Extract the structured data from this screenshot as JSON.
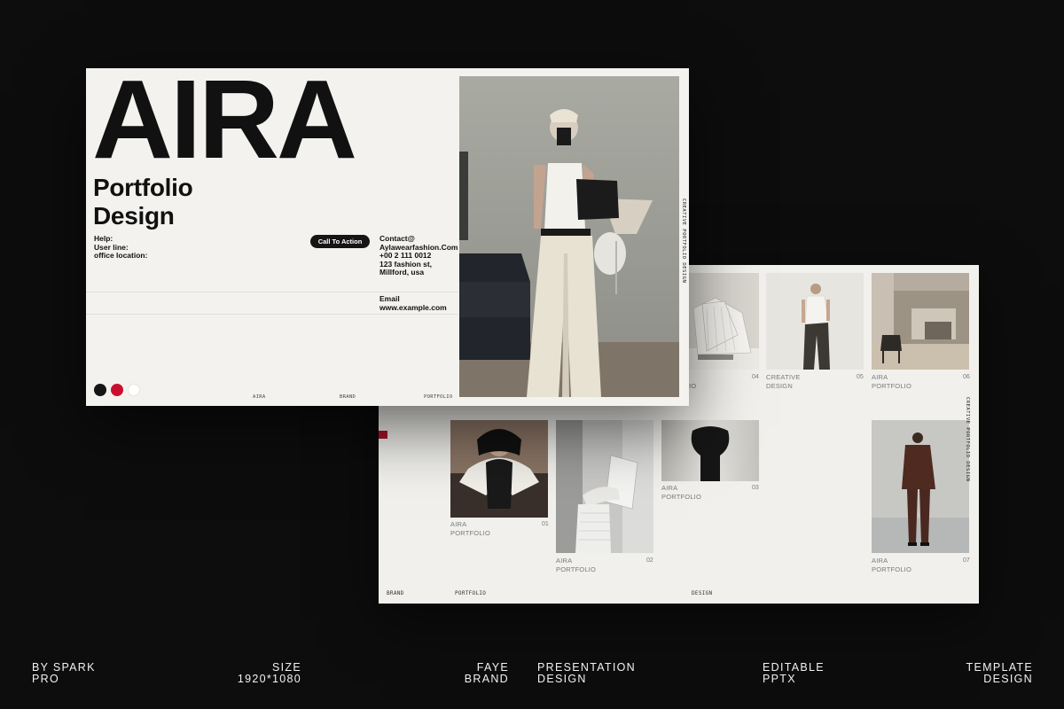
{
  "front_slide": {
    "title": "AIRA",
    "subtitle_line1": "Portfolio",
    "subtitle_line2": "Design",
    "help_lines": [
      "Help:",
      "User line:",
      "office location:"
    ],
    "cta_label": "Call To Action",
    "contact_lines": [
      "Contact@",
      "Aylawearfashion.Com",
      "+00 2 111 0012",
      "123 fashion st,",
      "Millford, usa"
    ],
    "email_lines": [
      "Email",
      "www.example.com"
    ],
    "footer": [
      "AIRA",
      "BRAND",
      "PORTFOLIO"
    ],
    "vertical_label": "CREATIVE PORTFOLIO DESIGN",
    "swatch_colors": [
      "#151515",
      "#c8102e",
      "#ffffff"
    ]
  },
  "back_slide": {
    "items": [
      {
        "num": "01",
        "line1": "AIRA",
        "line2": "PORTFOLIO"
      },
      {
        "num": "02",
        "line1": "AIRA",
        "line2": "PORTFOLIO"
      },
      {
        "num": "03",
        "line1": "AIRA",
        "line2": "PORTFOLIO"
      },
      {
        "num": "04",
        "line1": "",
        "line2": "IO"
      },
      {
        "num": "05",
        "line1": "CREATIVE",
        "line2": "DESIGN"
      },
      {
        "num": "06",
        "line1": "AIRA",
        "line2": "PORTFOLIO"
      },
      {
        "num": "07",
        "line1": "AIRA",
        "line2": "PORTFOLIO"
      }
    ],
    "footer": [
      "BRAND",
      "PORTFOLIO",
      "DESIGN"
    ],
    "vertical_label": "CREATIVE PORTFOLIO DESIGN"
  },
  "bottom_bar": [
    {
      "line1": "BY SPARK",
      "line2": "PRO"
    },
    {
      "line1": "SIZE",
      "line2": "1920*1080"
    },
    {
      "line1": "FAYE",
      "line2": "BRAND"
    },
    {
      "line1": "PRESENTATION",
      "line2": "DESIGN"
    },
    {
      "line1": "EDITABLE",
      "line2": "PPTX"
    },
    {
      "line1": "TEMPLATE",
      "line2": "DESIGN"
    }
  ]
}
